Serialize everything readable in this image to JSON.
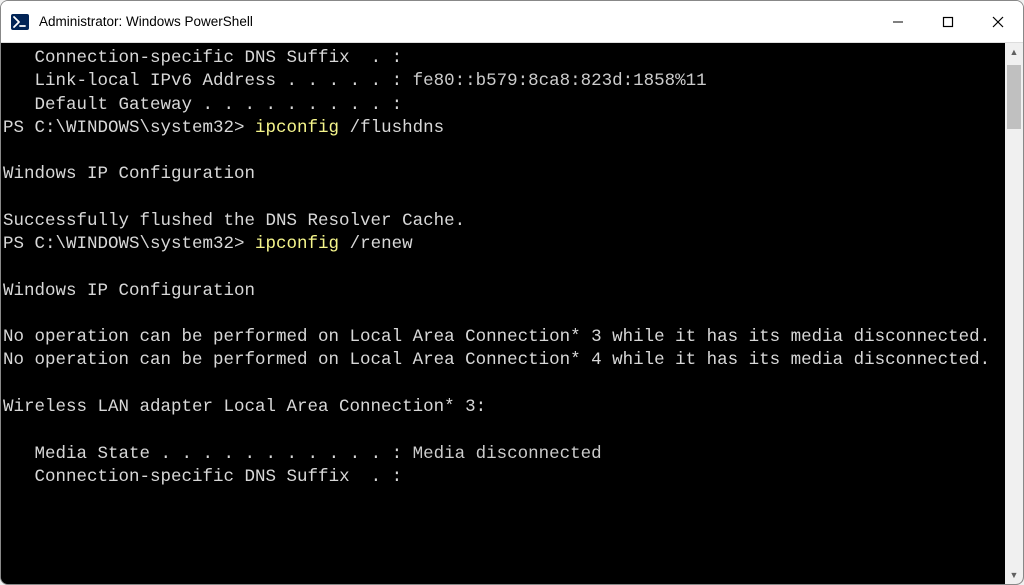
{
  "window": {
    "title": "Administrator: Windows PowerShell"
  },
  "terminal": {
    "lines": [
      {
        "indent": "   ",
        "label": "Connection-specific DNS Suffix  . :",
        "value": ""
      },
      {
        "indent": "   ",
        "label": "Link-local IPv6 Address . . . . . :",
        "value": " fe80::b579:8ca8:823d:1858%11"
      },
      {
        "indent": "   ",
        "label": "Default Gateway . . . . . . . . . :",
        "value": ""
      }
    ],
    "prompt1": "PS C:\\WINDOWS\\system32> ",
    "cmd1": "ipconfig ",
    "arg1": "/flushdns",
    "blank": "",
    "ipconfig_header": "Windows IP Configuration",
    "flush_msg": "Successfully flushed the DNS Resolver Cache.",
    "prompt2": "PS C:\\WINDOWS\\system32> ",
    "cmd2": "ipconfig ",
    "arg2": "/renew",
    "noop1": "No operation can be performed on Local Area Connection* 3 while it has its media disconnected.",
    "noop2": "No operation can be performed on Local Area Connection* 4 while it has its media disconnected.",
    "adapter_header": "Wireless LAN adapter Local Area Connection* 3:",
    "adapter_lines": [
      {
        "indent": "   ",
        "label": "Media State . . . . . . . . . . . :",
        "value": " Media disconnected"
      },
      {
        "indent": "   ",
        "label": "Connection-specific DNS Suffix  . :",
        "value": ""
      }
    ]
  }
}
